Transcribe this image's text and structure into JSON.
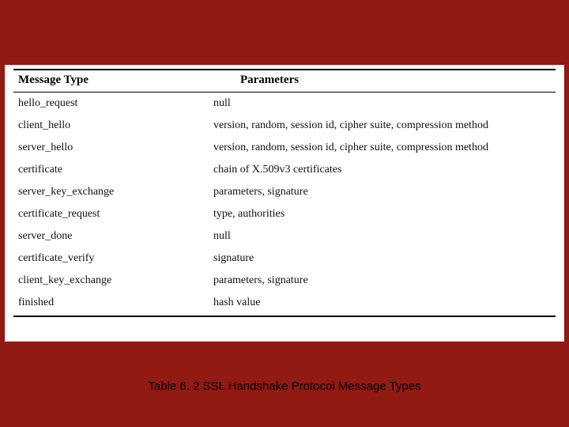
{
  "table": {
    "headers": {
      "message_type": "Message Type",
      "parameters": "Parameters"
    },
    "rows": [
      {
        "type": "hello_request",
        "params": "null"
      },
      {
        "type": "client_hello",
        "params": "version, random, session id, cipher suite, compression method"
      },
      {
        "type": "server_hello",
        "params": "version, random, session id, cipher suite, compression method"
      },
      {
        "type": "certificate",
        "params": "chain of X.509v3 certificates"
      },
      {
        "type": "server_key_exchange",
        "params": "parameters, signature"
      },
      {
        "type": "certificate_request",
        "params": "type, authorities"
      },
      {
        "type": "server_done",
        "params": "null"
      },
      {
        "type": "certificate_verify",
        "params": "signature"
      },
      {
        "type": "client_key_exchange",
        "params": "parameters, signature"
      },
      {
        "type": "finished",
        "params": "hash value"
      }
    ]
  },
  "caption": "Table 6. 2  SSL Handshake Protocol Message Types"
}
